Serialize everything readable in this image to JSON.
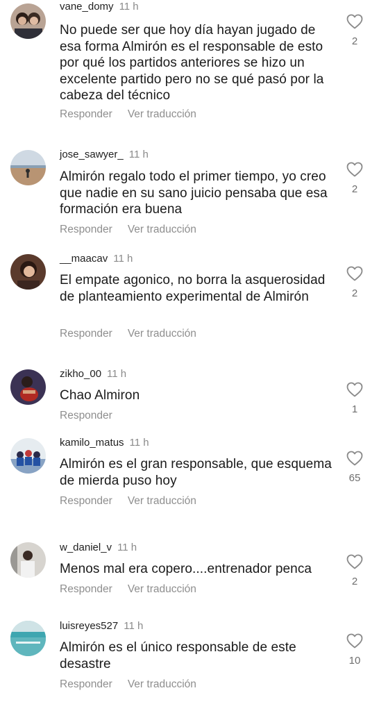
{
  "actions": {
    "reply_label": "Responder",
    "translate_label": "Ver traducción"
  },
  "icons": {
    "like": "heart-outline-icon"
  },
  "comments": [
    {
      "username": "vane_domy",
      "time": "11 h",
      "text": "No puede ser que hoy día hayan jugado de esa forma Almirón es el responsable de esto por qué los partidos anteriores se hizo un excelente partido pero no se qué pasó por la cabeza del técnico",
      "likes": "2"
    },
    {
      "username": "jose_sawyer_",
      "time": "11 h",
      "text": "Almirón regalo todo el primer tiempo, yo creo que nadie en su sano juicio pensaba que esa formación era buena",
      "likes": "2"
    },
    {
      "username": "__maacav",
      "time": "11 h",
      "text": "El empate agonico, no borra la asquerosidad de planteamiento experimental de Almirón",
      "likes": "2"
    },
    {
      "username": "zikho_00",
      "time": "11 h",
      "text": "Chao Almiron",
      "likes": "1"
    },
    {
      "username": "kamilo_matus",
      "time": "11 h",
      "text": "Almirón es el gran responsable, que esquema de mierda puso hoy",
      "likes": "65"
    },
    {
      "username": "w_daniel_v",
      "time": "11 h",
      "text": "Menos mal era copero....entrenador penca",
      "likes": "2"
    },
    {
      "username": "luisreyes527",
      "time": "11 h",
      "text": "Almirón es el único responsable de este desastre",
      "likes": "10"
    }
  ]
}
